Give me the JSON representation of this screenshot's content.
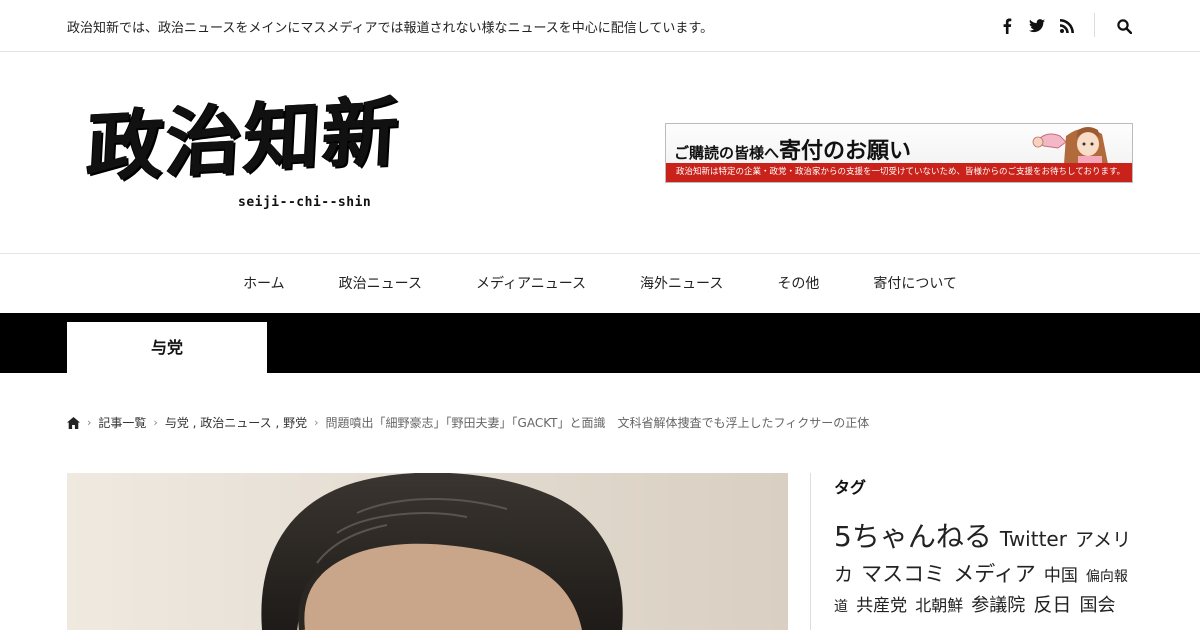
{
  "topbar": {
    "description": "政治知新では、政治ニュースをメインにマスメディアでは報道されない様なニュースを中心に配信しています。",
    "icons": [
      "facebook-icon",
      "twitter-icon",
      "rss-icon",
      "search-icon"
    ]
  },
  "logo": {
    "main": "政治知新",
    "sub": "seiji--chi--shin"
  },
  "banner": {
    "headline_small_1": "ご購読の皆様へ",
    "headline_large": "寄付のお願い",
    "footer": "政治知新は特定の企業・政党・政治家からの支援を一切受けていないため、皆様からのご支援をお待ちしております。"
  },
  "nav": {
    "items": [
      {
        "label": "ホーム"
      },
      {
        "label": "政治ニュース"
      },
      {
        "label": "メディアニュース"
      },
      {
        "label": "海外ニュース"
      },
      {
        "label": "その他"
      },
      {
        "label": "寄付について"
      }
    ]
  },
  "category": {
    "label": "与党"
  },
  "breadcrumb": {
    "home_icon": "home-icon",
    "items": [
      {
        "label": "記事一覧"
      },
      {
        "label": "与党 , 政治ニュース , 野党"
      },
      {
        "label": "問題噴出「細野豪志」「野田夫妻」「GACKT」と面識　文科省解体捜査でも浮上したフィクサーの正体"
      }
    ]
  },
  "sidebar": {
    "title": "タグ",
    "tags": [
      {
        "label": "5ちゃんねる",
        "size": 28
      },
      {
        "label": "Twitter",
        "size": 20
      },
      {
        "label": "アメリカ",
        "size": 19
      },
      {
        "label": "マスコミ",
        "size": 21
      },
      {
        "label": "メディア",
        "size": 21
      },
      {
        "label": "中国",
        "size": 17
      },
      {
        "label": "偏向報道",
        "size": 14
      },
      {
        "label": "共産党",
        "size": 17
      },
      {
        "label": "北朝鮮",
        "size": 16
      },
      {
        "label": "参議院",
        "size": 18
      },
      {
        "label": "反日",
        "size": 19
      },
      {
        "label": "国会",
        "size": 18
      }
    ]
  }
}
